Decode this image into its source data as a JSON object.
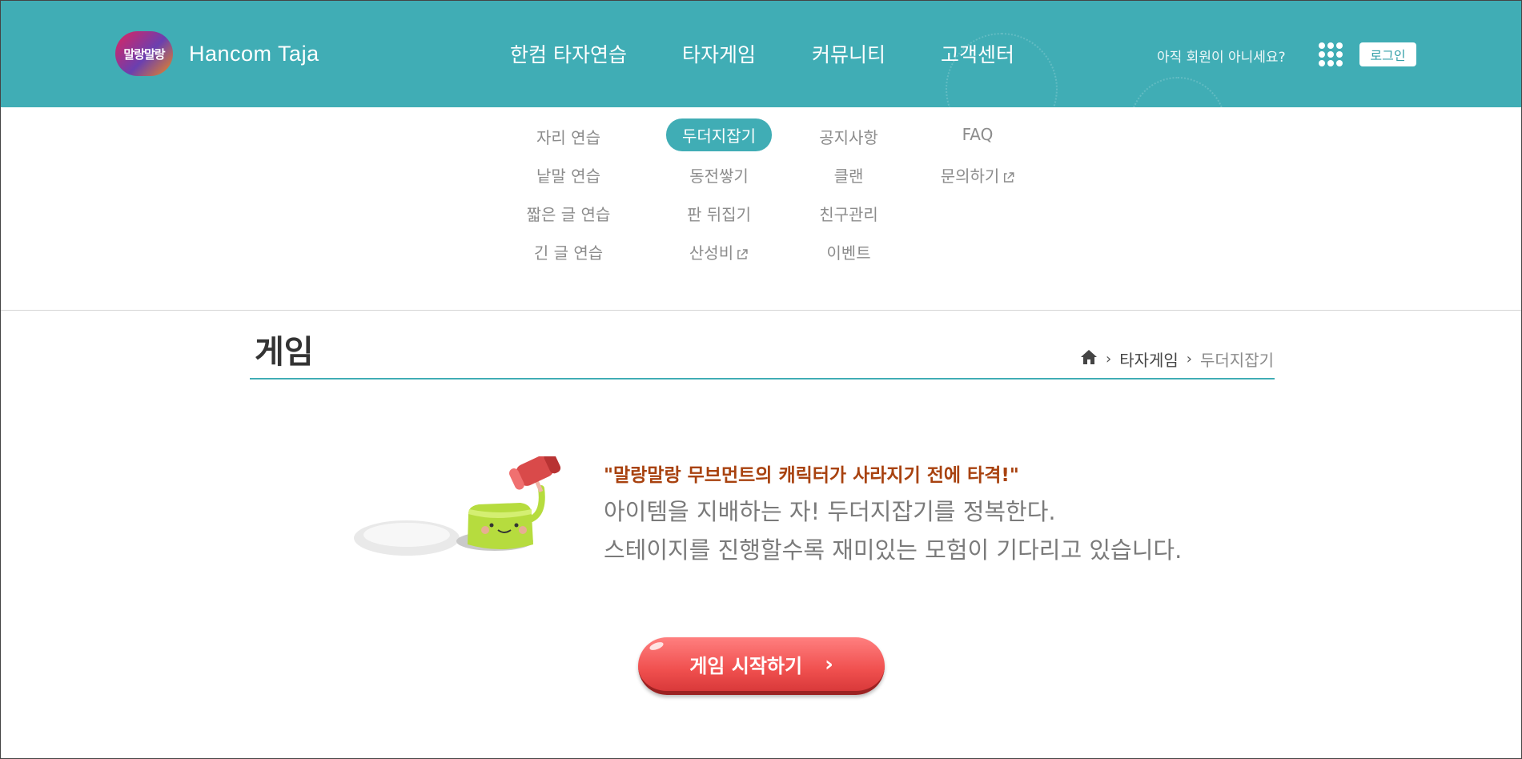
{
  "header": {
    "logo_badge": "말랑말랑",
    "logo_text": "Hancom Taja",
    "nav": [
      "한컴 타자연습",
      "타자게임",
      "커뮤니티",
      "고객센터"
    ],
    "not_member": "아직 회원이 아니세요?",
    "apps_icon": "grid-dots-icon",
    "login_label": "로그인",
    "color": "#40adb5"
  },
  "submenu": {
    "col1": [
      "자리 연습",
      "낱말 연습",
      "짧은 글 연습",
      "긴 글 연습"
    ],
    "col2": [
      "두더지잡기",
      "동전쌓기",
      "판 뒤집기",
      "산성비"
    ],
    "col3": [
      "공지사항",
      "클랜",
      "친구관리",
      "이벤트"
    ],
    "col4": [
      "FAQ",
      "문의하기"
    ],
    "active": "두더지잡기"
  },
  "page": {
    "title": "게임",
    "breadcrumb": [
      "타자게임",
      "두더지잡기"
    ]
  },
  "intro": {
    "headline": "\"말랑말랑 무브먼트의 캐릭터가 사라지기 전에 타격!\"",
    "line1": "아이템을 지배하는 자! 두더지잡기를 정복한다.",
    "line2": "스테이지를 진행할수록 재미있는 모험이 기다리고 있습니다."
  },
  "start_button": "게임 시작하기"
}
